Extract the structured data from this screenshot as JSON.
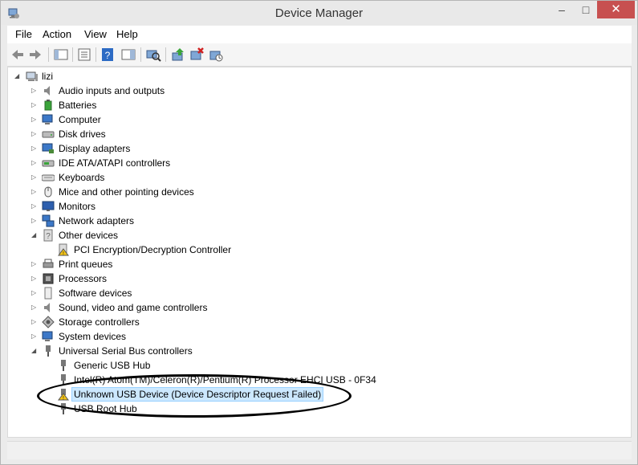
{
  "window": {
    "title": "Device Manager",
    "minimize": "–",
    "maximize": "□",
    "close": "✕"
  },
  "menu": {
    "file": "File",
    "action": "Action",
    "view": "View",
    "help": "Help"
  },
  "toolbar": [
    "back-icon",
    "forward-icon",
    "show-hide-console-tree-icon",
    "properties-icon",
    "help-icon",
    "action-pane-icon",
    "scan-hardware-icon",
    "update-driver-icon",
    "uninstall-icon",
    "enable-device-icon"
  ],
  "tree": {
    "root": "lizi",
    "categories": {
      "audio": "Audio inputs and outputs",
      "batteries": "Batteries",
      "computer": "Computer",
      "disk": "Disk drives",
      "display": "Display adapters",
      "ide": "IDE ATA/ATAPI controllers",
      "keyboards": "Keyboards",
      "mice": "Mice and other pointing devices",
      "monitors": "Monitors",
      "network": "Network adapters",
      "other": "Other devices",
      "print": "Print queues",
      "processors": "Processors",
      "software": "Software devices",
      "sound": "Sound, video and game controllers",
      "storage": "Storage controllers",
      "system": "System devices",
      "usb": "Universal Serial Bus controllers"
    },
    "other_children": {
      "pci": "PCI Encryption/Decryption Controller"
    },
    "usb_children": {
      "generic_hub": "Generic USB Hub",
      "ehci": "Intel(R) Atom(TM)/Celeron(R)/Pentium(R) Processor EHCI USB - 0F34",
      "unknown": "Unknown USB Device (Device Descriptor Request Failed)",
      "root_hub": "USB Root Hub"
    }
  },
  "colors": {
    "selection": "#cce8ff",
    "close_button": "#c75050",
    "warning": "#f5c518"
  }
}
